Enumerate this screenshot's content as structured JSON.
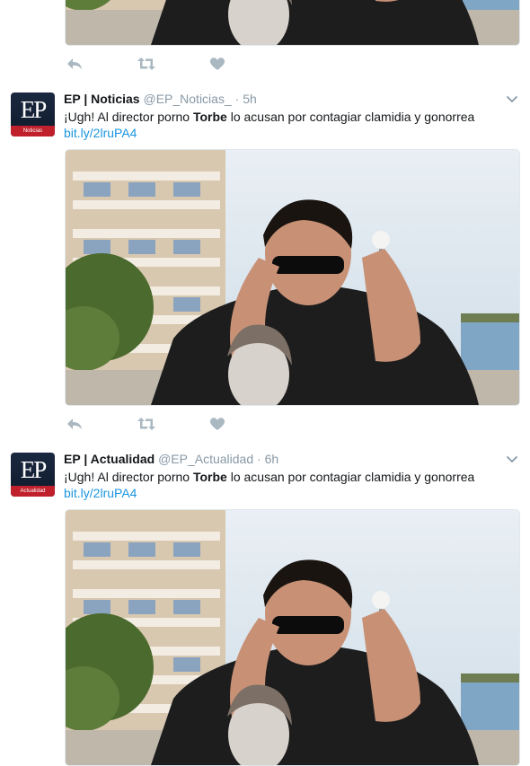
{
  "colors": {
    "accent": "#1b95e0",
    "muted": "#8899a6",
    "icon": "#aab8c2",
    "border": "#e6ecf0"
  },
  "icons": [
    "reply-icon",
    "retweet-icon",
    "like-icon",
    "chevron-down-icon"
  ],
  "tweets": [
    {
      "avatar_text": "EP",
      "avatar_band": "Noticias",
      "name": "EP | Noticias",
      "handle": "@EP_Noticias_",
      "dot": "·",
      "time": "5h",
      "text_before": "¡Ugh! Al director porno ",
      "text_bold": "Torbe",
      "text_after": " lo acusan por contagiar clamidia y gonorrea",
      "link": "bit.ly/2lruPA4"
    },
    {
      "avatar_text": "EP",
      "avatar_band": "Actualidad",
      "name": "EP | Actualidad",
      "handle": "@EP_Actualidad",
      "dot": "·",
      "time": "6h",
      "text_before": "¡Ugh! Al director porno ",
      "text_bold": "Torbe",
      "text_after": " lo acusan por contagiar clamidia y gonorrea",
      "link": "bit.ly/2lruPA4"
    }
  ]
}
